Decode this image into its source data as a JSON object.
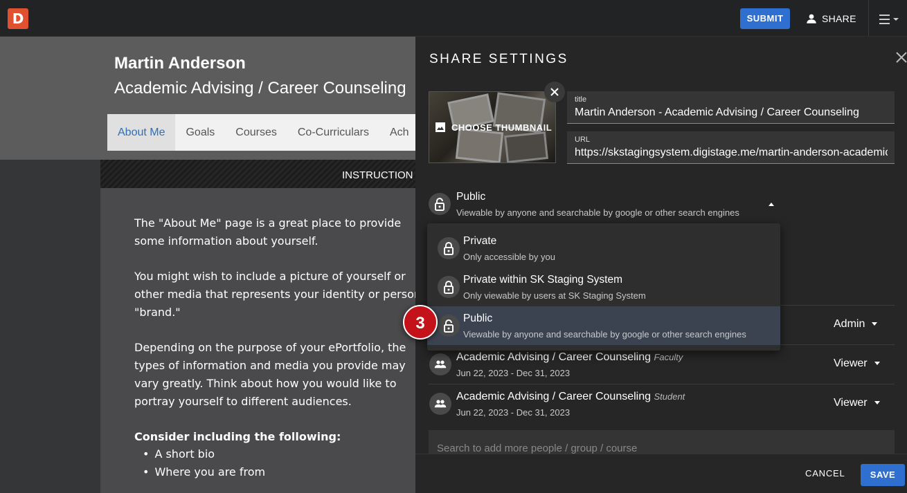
{
  "topbar": {
    "logo_letter": "D",
    "submit_label": "SUBMIT",
    "share_label": "SHARE"
  },
  "page": {
    "name": "Martin Anderson",
    "subtitle": "Academic Advising / Career Counseling",
    "tabs": [
      "About Me",
      "Goals",
      "Courses",
      "Co-Curriculars",
      "Ach"
    ],
    "instructions_label": "INSTRUCTION",
    "paragraphs": [
      "The \"About Me\" page is a great place to provide some information about yourself.",
      "You might wish to include a picture of yourself or other media that represents your identity or personal \"brand.\"",
      "Depending on the purpose of your ePortfolio, the types of information and media you provide may vary greatly. Think about how you would like to portray yourself to different audiences."
    ],
    "consider_heading": "Consider including the following:",
    "bullets": [
      "A short bio",
      "Where you are from"
    ]
  },
  "share": {
    "title": "SHARE SETTINGS",
    "thumbnail_label": "CHOOSE THUMBNAIL",
    "title_field": {
      "label": "title",
      "value": "Martin Anderson - Academic Advising / Career Counseling"
    },
    "url_field": {
      "label": "URL",
      "value": "https://skstagingsystem.digistage.me/martin-anderson-academic-advising-career-counseling"
    },
    "visibility": {
      "selected_title": "Public",
      "selected_desc": "Viewable by anyone and searchable by google or other search engines",
      "options": [
        {
          "title": "Private",
          "desc": "Only accessible by you"
        },
        {
          "title": "Private within SK Staging System",
          "desc": "Only viewable by users at SK Staging System"
        },
        {
          "title": "Public",
          "desc": "Viewable by anyone and searchable by google or other search engines"
        }
      ]
    },
    "members": [
      {
        "role": "Admin"
      },
      {
        "name": "Academic Advising / Career Counseling",
        "type": "Faculty",
        "dates": "Jun 22, 2023 - Dec 31, 2023",
        "role": "Viewer"
      },
      {
        "name": "Academic Advising / Career Counseling",
        "type": "Student",
        "dates": "Jun 22, 2023 - Dec 31, 2023",
        "role": "Viewer"
      }
    ],
    "search_placeholder": "Search to add more people / group / course",
    "cancel_label": "CANCEL",
    "save_label": "SAVE"
  },
  "annotation": {
    "step": "3",
    "color": "#c4121a"
  },
  "colors": {
    "accent": "#2f6fd0",
    "logo": "#e0512f"
  }
}
